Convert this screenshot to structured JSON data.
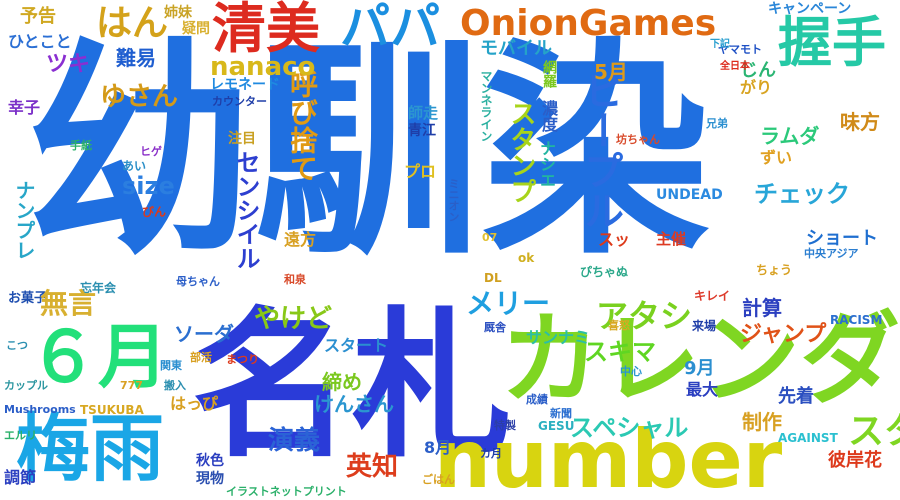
{
  "words": [
    {
      "text": "幼馴染",
      "color": "#1f6fe0",
      "vertical": false
    },
    {
      "text": "名札",
      "color": "#2a3bd8",
      "vertical": false
    },
    {
      "text": "number",
      "color": "#d8d410",
      "vertical": false
    },
    {
      "text": "カレンダ",
      "color": "#7fd622",
      "vertical": false
    },
    {
      "text": "梅雨",
      "color": "#1aa6e6",
      "vertical": false
    },
    {
      "text": "６月",
      "color": "#22e07a",
      "vertical": false
    },
    {
      "text": "清美",
      "color": "#dd2b1f",
      "vertical": false
    },
    {
      "text": "パパ",
      "color": "#1b8fe0",
      "vertical": false
    },
    {
      "text": "OnionGames",
      "color": "#e06a12",
      "vertical": false
    },
    {
      "text": "握手",
      "color": "#25c9a6",
      "vertical": false
    },
    {
      "text": "はん",
      "color": "#d4a21a",
      "vertical": false
    },
    {
      "text": "ピープル",
      "color": "#2a6be0",
      "vertical": true
    },
    {
      "text": "呼び捨て",
      "color": "#e09a15",
      "vertical": true
    },
    {
      "text": "センシイル",
      "color": "#2d3fd0",
      "vertical": true
    },
    {
      "text": "nanaco",
      "color": "#d8b81a",
      "vertical": false
    },
    {
      "text": "アタシ",
      "color": "#7ad11f",
      "vertical": false
    },
    {
      "text": "メリー",
      "color": "#1f9fe0",
      "vertical": false
    },
    {
      "text": "やけど",
      "color": "#88c817",
      "vertical": false
    },
    {
      "text": "演義",
      "color": "#2b63d6",
      "vertical": false
    },
    {
      "text": "英知",
      "color": "#dd3d1c",
      "vertical": false
    },
    {
      "text": "チェック",
      "color": "#28a6d8",
      "vertical": false
    },
    {
      "text": "スタンプ",
      "color": "#a8d41a",
      "vertical": true
    },
    {
      "text": "ジャンプ",
      "color": "#e05218",
      "vertical": false
    },
    {
      "text": "スペシャル",
      "color": "#2bc9b3",
      "vertical": false
    },
    {
      "text": "スキマ",
      "color": "#5fd622",
      "vertical": false
    },
    {
      "text": "サンナミ",
      "color": "#2cbfa5",
      "vertical": false
    },
    {
      "text": "size",
      "color": "#2b7ee0",
      "vertical": false
    },
    {
      "text": "ゆさん",
      "color": "#d49a18",
      "vertical": false
    },
    {
      "text": "難易",
      "color": "#1f5ed0",
      "vertical": false
    },
    {
      "text": "ツキ",
      "color": "#8a2fd1",
      "vertical": false
    },
    {
      "text": "予告",
      "color": "#d0a822",
      "vertical": false
    },
    {
      "text": "姉妹",
      "color": "#c9a325",
      "vertical": false
    },
    {
      "text": "疑問",
      "color": "#d8b030",
      "vertical": false
    },
    {
      "text": "ひとこと",
      "color": "#2b6fd4",
      "vertical": false
    },
    {
      "text": "幸子",
      "color": "#7b2fc8",
      "vertical": false
    },
    {
      "text": "じん",
      "color": "#2bb573",
      "vertical": false
    },
    {
      "text": "モバイル",
      "color": "#25a3c8",
      "vertical": false
    },
    {
      "text": "レモネード",
      "color": "#1f8ae0",
      "vertical": false
    },
    {
      "text": "5月",
      "color": "#dd9a1a",
      "vertical": false
    },
    {
      "text": "ラムダ",
      "color": "#2bc97a",
      "vertical": false
    },
    {
      "text": "味方",
      "color": "#d08a18",
      "vertical": false
    },
    {
      "text": "ずい",
      "color": "#e0a020",
      "vertical": false
    },
    {
      "text": "がり",
      "color": "#d8a422",
      "vertical": false
    },
    {
      "text": "キャンペーン",
      "color": "#2a86d8",
      "vertical": false
    },
    {
      "text": "ヤマモト",
      "color": "#1d4fc4",
      "vertical": false
    },
    {
      "text": "下記",
      "color": "#2ba0d0",
      "vertical": false
    },
    {
      "text": "全日本",
      "color": "#dd2a1c",
      "vertical": false
    },
    {
      "text": "兄弟",
      "color": "#2b8fd0",
      "vertical": false
    },
    {
      "text": "坊ちゃん",
      "color": "#d84a2a",
      "vertical": false
    },
    {
      "text": "マンネライン",
      "color": "#2bb0a0",
      "vertical": true
    },
    {
      "text": "濃度",
      "color": "#2b5ec8",
      "vertical": true
    },
    {
      "text": "網羅",
      "color": "#7bc81f",
      "vertical": true
    },
    {
      "text": "ナシエ",
      "color": "#22b5a0",
      "vertical": true
    },
    {
      "text": "師走",
      "color": "#2b96d0",
      "vertical": false
    },
    {
      "text": "青江",
      "color": "#1f3ea8",
      "vertical": false
    },
    {
      "text": "注目",
      "color": "#c9a021",
      "vertical": false
    },
    {
      "text": "プロ",
      "color": "#e0c020",
      "vertical": false
    },
    {
      "text": "ミニオン",
      "color": "#2a5fc8",
      "vertical": true
    },
    {
      "text": "UNDEAD",
      "color": "#2b8ae0",
      "vertical": false
    },
    {
      "text": "スッ",
      "color": "#dd3a1a",
      "vertical": false
    },
    {
      "text": "主催",
      "color": "#dd3a22",
      "vertical": false
    },
    {
      "text": "ショート",
      "color": "#1f6fd0",
      "vertical": false
    },
    {
      "text": "計算",
      "color": "#2b3fc0",
      "vertical": false
    },
    {
      "text": "スタ",
      "color": "#7fd622",
      "vertical": false
    },
    {
      "text": "中央アジア",
      "color": "#2b7ed0",
      "vertical": false
    },
    {
      "text": "ちょう",
      "color": "#d8a020",
      "vertical": false
    },
    {
      "text": "キレイ",
      "color": "#dd3a2a",
      "vertical": false
    },
    {
      "text": "RACISM",
      "color": "#2b6fd0",
      "vertical": false
    },
    {
      "text": "来場",
      "color": "#1f3ea8",
      "vertical": false
    },
    {
      "text": "喜怒",
      "color": "#d8a822",
      "vertical": false
    },
    {
      "text": "ぴちゃぬ",
      "color": "#2ba88a",
      "vertical": false
    },
    {
      "text": "DL",
      "color": "#d0a020",
      "vertical": false
    },
    {
      "text": "ok",
      "color": "#d0b020",
      "vertical": false
    },
    {
      "text": "07",
      "color": "#e0c030",
      "vertical": false
    },
    {
      "text": "手紙",
      "color": "#2bb06a",
      "vertical": false
    },
    {
      "text": "あい",
      "color": "#2b8fc8",
      "vertical": false
    },
    {
      "text": "ヒゲ",
      "color": "#8a2fc8",
      "vertical": false
    },
    {
      "text": "ナンプレ",
      "color": "#28a6c8",
      "vertical": true
    },
    {
      "text": "びん",
      "color": "#dd3a1c",
      "vertical": false
    },
    {
      "text": "遠方",
      "color": "#d8a022",
      "vertical": false
    },
    {
      "text": "忘年会",
      "color": "#2b8fb0",
      "vertical": false
    },
    {
      "text": "母ちゃん",
      "color": "#2b5ec8",
      "vertical": false
    },
    {
      "text": "和泉",
      "color": "#d84a2a",
      "vertical": false
    },
    {
      "text": "お菓子",
      "color": "#1f4fb0",
      "vertical": false
    },
    {
      "text": "無言",
      "color": "#d8b030",
      "vertical": false
    },
    {
      "text": "ソーダ",
      "color": "#2b6fd0",
      "vertical": false
    },
    {
      "text": "スタート",
      "color": "#2b8fd0",
      "vertical": false
    },
    {
      "text": "締め",
      "color": "#7bc81f",
      "vertical": false
    },
    {
      "text": "けんさん",
      "color": "#2b96d0",
      "vertical": false
    },
    {
      "text": "9月",
      "color": "#2b8fd0",
      "vertical": false
    },
    {
      "text": "最大",
      "color": "#2b3fc0",
      "vertical": false
    },
    {
      "text": "先着",
      "color": "#2b4fc0",
      "vertical": false
    },
    {
      "text": "制作",
      "color": "#d8a022",
      "vertical": false
    },
    {
      "text": "成績",
      "color": "#2b5ec8",
      "vertical": false
    },
    {
      "text": "新聞",
      "color": "#2b6fd0",
      "vertical": false
    },
    {
      "text": "特製",
      "color": "#2b3fa8",
      "vertical": false
    },
    {
      "text": "GESU",
      "color": "#2bb0c0",
      "vertical": false
    },
    {
      "text": "AGAINST",
      "color": "#2bc0d0",
      "vertical": false
    },
    {
      "text": "彼岸花",
      "color": "#dd3a1c",
      "vertical": false
    },
    {
      "text": "8月",
      "color": "#2b5ec8",
      "vertical": false
    },
    {
      "text": "カ月",
      "color": "#1f3ea8",
      "vertical": false
    },
    {
      "text": "秋色",
      "color": "#2b3fc0",
      "vertical": false
    },
    {
      "text": "現物",
      "color": "#2b4fb0",
      "vertical": false
    },
    {
      "text": "イラストネットプリント",
      "color": "#2bb06a",
      "vertical": false
    },
    {
      "text": "ごはん",
      "color": "#d8a022",
      "vertical": false
    },
    {
      "text": "はっぴ",
      "color": "#d8a022",
      "vertical": false
    },
    {
      "text": "搬入",
      "color": "#2b8fb0",
      "vertical": false
    },
    {
      "text": "TSUKUBA",
      "color": "#d8a822",
      "vertical": false
    },
    {
      "text": "Mushrooms",
      "color": "#2b5ec8",
      "vertical": false
    },
    {
      "text": "777",
      "color": "#d8a022",
      "vertical": false
    },
    {
      "text": "カップル",
      "color": "#2b96a0",
      "vertical": false
    },
    {
      "text": "関東",
      "color": "#2b8fd0",
      "vertical": false
    },
    {
      "text": "部活",
      "color": "#d8a022",
      "vertical": false
    },
    {
      "text": "まつり",
      "color": "#dd3a1c",
      "vertical": false
    },
    {
      "text": "中心",
      "color": "#2b96d0",
      "vertical": false
    },
    {
      "text": "こつ",
      "color": "#2b8fb0",
      "vertical": false
    },
    {
      "text": "エルリ",
      "color": "#2bb06a",
      "vertical": false
    },
    {
      "text": "調節",
      "color": "#2b3fc0",
      "vertical": false
    },
    {
      "text": "厩舎",
      "color": "#2b4fc0",
      "vertical": false
    },
    {
      "text": "カウンター",
      "color": "#1f3ea8",
      "vertical": false
    }
  ]
}
